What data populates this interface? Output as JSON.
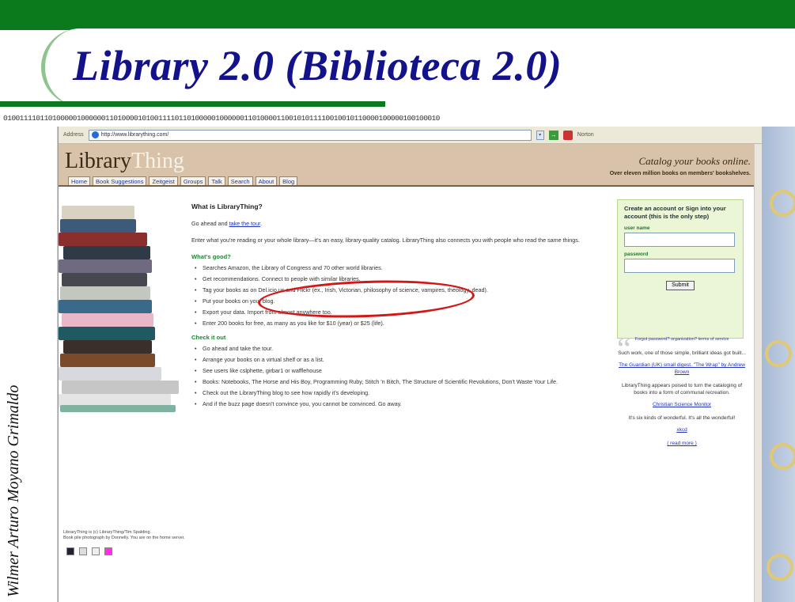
{
  "slide": {
    "title": "Library 2.0 (Biblioteca 2.0)",
    "binary": "01001111011010000010000001101000010100111101101000001000000110100001100101011110010010110000100000100100010",
    "author": "Wilmer Arturo Moyano Grimaldo"
  },
  "browser": {
    "address_label": "Address",
    "url": "http://www.librarything.com/",
    "toolbar_right": "Norton"
  },
  "lt": {
    "logo_library": "Library",
    "logo_thing": "Thing",
    "tagline": "Catalog your books online.",
    "subtag": "Over eleven million books on members' bookshelves.",
    "tabs": [
      "Home",
      "Book Suggestions",
      "Zeitgeist",
      "Groups",
      "Talk",
      "Search",
      "About",
      "Blog"
    ],
    "heading": "What is LibraryThing?",
    "intro_pre": "Go ahead and ",
    "intro_link": "take the tour",
    "intro_post": ".",
    "description": "Enter what you're reading or your whole library—it's an easy, library-quality catalog. LibraryThing also connects you with people who read the same things.",
    "whats_good_title": "What's good?",
    "whats_good": [
      "Searches Amazon, the Library of Congress and 70 other world libraries.",
      "Get recommendations. Connect to people with similar libraries.",
      "Tag your books as on Del.icio.us and Flickr (ex., Irish, Victorian, philosophy of science, vampires, theology, dead).",
      "Put your books on your blog.",
      "Export your data. Import from almost anywhere too.",
      "Enter 200 books for free, as many as you like for $10 (year) or $25 (life)."
    ],
    "check_title": "Check it out",
    "check_items": [
      "Go ahead and take the tour.",
      "Arrange your books on a virtual shelf or as a list.",
      "See users like cslphette, girbar1 or wafflehouse",
      "Books: Notebooks, The Horse and His Boy, Programming Ruby, Stitch 'n Bitch, The Structure of Scientific Revolutions, Don't Waste Your Life.",
      "Check out the LibraryThing blog to see how rapidly it's developing.",
      "And if the buzz page doesn't convince you, you cannot be convinced. Go away."
    ],
    "signbox": {
      "title": "Create an account or Sign into your account (this is the only step)",
      "user_label": "user name",
      "pass_label": "password",
      "submit": "Submit",
      "forgot": "Forgot password? organization? terms of service"
    },
    "quotes": [
      {
        "text": "Such work, one of those simple, brilliant ideas got built...",
        "by": "The Guardian (UK) small digest. \"The Wrap\" by Andrew Brown"
      },
      {
        "text": "LibraryThing appears poised to turn the cataloging of books into a form of communal recreation.",
        "by": "Christian Science Monitor"
      },
      {
        "text": "It's six kinds of wonderful. It's all the wonderful!",
        "by": "xkcd"
      }
    ],
    "read_more": "( read more )",
    "footer_line1": "LibraryThing is (c) LibraryThing/Tim Spalding.",
    "footer_line2": "Book pile photograph by Donnelly. You are on the home server."
  },
  "colors": {
    "green": "#0b7a1c",
    "title_blue": "#13128a",
    "lt_tan": "#d8c3aa",
    "annotation_red": "#d31717"
  }
}
